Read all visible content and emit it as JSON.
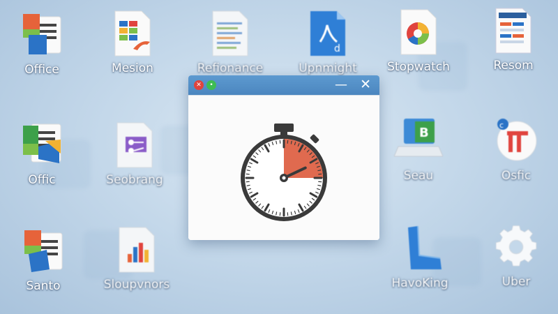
{
  "desktop": {
    "icons": [
      {
        "label": "Office",
        "icon": "office-icon"
      },
      {
        "label": "Mesion",
        "icon": "spreadsheet-doc-icon"
      },
      {
        "label": "Refionance",
        "icon": "document-icon"
      },
      {
        "label": "Upnmight",
        "icon": "pdf-document-icon"
      },
      {
        "label": "Stopwatch",
        "icon": "pie-chart-doc-icon"
      },
      {
        "label": "Resom",
        "icon": "calendar-doc-icon"
      },
      {
        "label": "Offic",
        "icon": "office-icon"
      },
      {
        "label": "Seobrang",
        "icon": "purple-doc-icon"
      },
      {
        "label": "Seau",
        "icon": "laptop-b-icon"
      },
      {
        "label": "Osfic",
        "icon": "office-circle-icon"
      },
      {
        "label": "Santo",
        "icon": "office-icon"
      },
      {
        "label": "Sloupvnors",
        "icon": "chart-doc-icon"
      },
      {
        "label": "HavoKing",
        "icon": "blue-hook-icon"
      },
      {
        "label": "Uber",
        "icon": "gear-icon"
      }
    ]
  },
  "window": {
    "title": "",
    "minimize_glyph": "—",
    "close_glyph": "✕",
    "content_icon": "stopwatch-icon",
    "stopwatch_progress": 0.25
  },
  "colors": {
    "titlebar": "#4b86bf",
    "close_button": "#e0443e",
    "min_button": "#3ebd53",
    "stopwatch_segment": "#e06a4f",
    "stopwatch_body": "#3a3a3a"
  }
}
